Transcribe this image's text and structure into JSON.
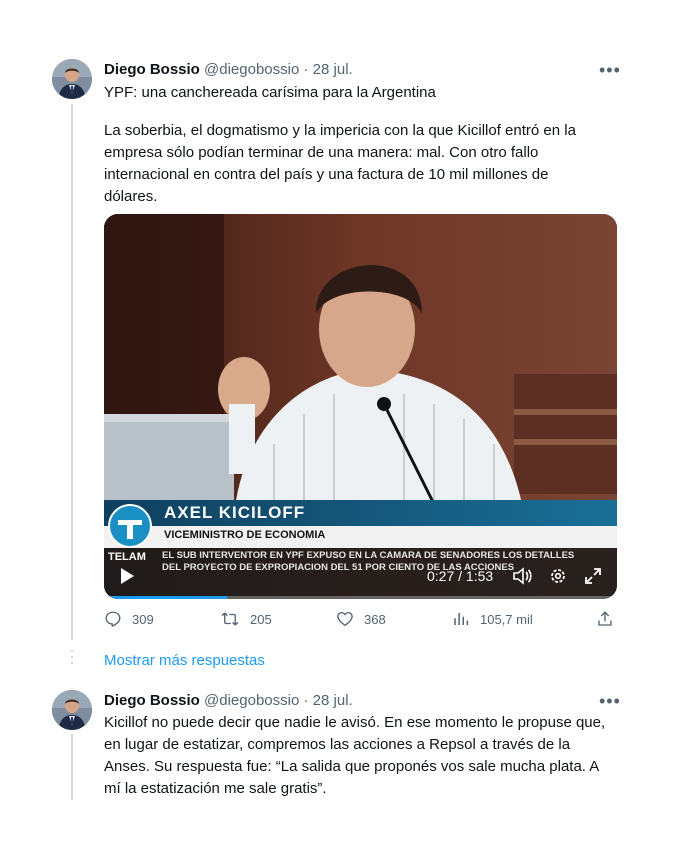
{
  "tweets": [
    {
      "author_name": "Diego Bossio",
      "handle": "@diegobossio",
      "separator": "·",
      "date": "28 jul.",
      "more_icon": "more-dots-icon",
      "lines": [
        "YPF: una canchereada carísima para la Argentina",
        "La soberbia, el dogmatismo y la impericia con la que Kicillof entró en la",
        "empresa sólo podían terminar de una manera: mal. Con otro fallo",
        "internacional en contra del país y una factura de 10 mil millones de",
        "dólares."
      ],
      "video": {
        "lower_third_name": "AXEL KICILOFF",
        "lower_third_title": "VICEMINISTRO DE ECONOMIA",
        "channel_logo": "TELAM",
        "ticker_line1": "EL SUB INTERVENTOR EN YPF EXPUSO EN LA CAMARA DE SENADORES LOS DETALLES",
        "ticker_line2": "DEL PROYECTO DE EXPROPIACION DEL 51 POR CIENTO DE LAS ACCIONES",
        "time": "0:27 / 1:53",
        "progress": 0.24
      },
      "stats": {
        "replies": "309",
        "retweets": "205",
        "likes": "368",
        "views": "105,7 mil"
      }
    },
    {
      "author_name": "Diego Bossio",
      "handle": "@diegobossio",
      "separator": "·",
      "date": "28 jul.",
      "lines": [
        "Kicillof no puede decir que nadie le avisó. En ese momento le propuse que,",
        "en lugar de estatizar, compremos las acciones a Repsol a través de la",
        "Anses. Su respuesta fue: “La salida que proponés vos sale mucha plata. A",
        "mí la estatización me sale gratis”."
      ]
    }
  ],
  "show_more_label": "Mostrar más respuestas",
  "colors": {
    "accent": "#1d9bf0",
    "muted": "#536471",
    "line": "#cfd9de"
  }
}
